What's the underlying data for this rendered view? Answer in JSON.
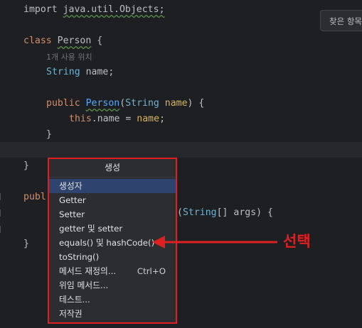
{
  "code": {
    "import_kw": "import",
    "import_path": "java.util.Objects;",
    "class_kw": "class",
    "class_name": "Person",
    "open_brace": "{",
    "usage_hint": "1개 사용 위치",
    "field_type": "String",
    "field_name": "name;",
    "public_kw": "public",
    "ctor_name": "Person",
    "paren_open": "(",
    "param_type": "String",
    "param_name": "name",
    "paren_close": ") {",
    "this_kw": "this",
    "dot_name": ".name = ",
    "assign_val": "name",
    "semicolon": ";",
    "close_inner": "}",
    "close_class": "}",
    "publ_partial": "publ",
    "main_params_open": "(",
    "main_param_type": "String",
    "main_param_rest": "[] args) {",
    "close_last": "}"
  },
  "find_box": {
    "label": "찾은 항목"
  },
  "popup": {
    "title": "생성",
    "items": [
      {
        "label": "생성자",
        "shortcut": ""
      },
      {
        "label": "Getter",
        "shortcut": ""
      },
      {
        "label": "Setter",
        "shortcut": ""
      },
      {
        "label": "getter 및 setter",
        "shortcut": ""
      },
      {
        "label": "equals() 및 hashCode()",
        "shortcut": ""
      },
      {
        "label": "toString()",
        "shortcut": ""
      },
      {
        "label": "메서드 재정의...",
        "shortcut": "Ctrl+O"
      },
      {
        "label": "위임 메서드...",
        "shortcut": ""
      },
      {
        "label": "테스트...",
        "shortcut": ""
      },
      {
        "label": "저작권",
        "shortcut": ""
      }
    ]
  },
  "annotation": {
    "label": "선택",
    "color": "#e02020"
  }
}
